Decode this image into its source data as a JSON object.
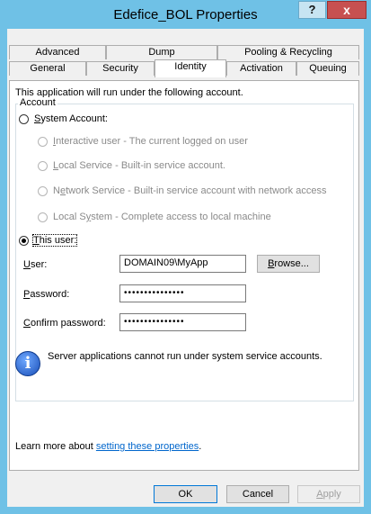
{
  "window": {
    "title": "Edefice_BOL Properties",
    "help_label": "?",
    "close_label": "x"
  },
  "tabs": {
    "row1": [
      "Advanced",
      "Dump",
      "Pooling & Recycling"
    ],
    "row2": [
      "General",
      "Security",
      "Identity",
      "Activation",
      "Queuing"
    ],
    "active": "Identity"
  },
  "identity": {
    "intro": "This application will run under the following account.",
    "group_label": "Account",
    "system_account": {
      "mnemonic": "S",
      "rest": "ystem Account:"
    },
    "options": [
      {
        "mnemonic": "I",
        "rest": "nteractive user - The current logged on user",
        "pre": ""
      },
      {
        "mnemonic": "L",
        "rest": "ocal Service - Built-in service account.",
        "pre": ""
      },
      {
        "pre": "N",
        "mnemonic": "e",
        "rest": "twork Service - Built-in service account with network access"
      },
      {
        "pre": "Local S",
        "mnemonic": "y",
        "rest": "stem - Complete access to local machine"
      }
    ],
    "this_user": {
      "mnemonic": "T",
      "rest": "his user:"
    },
    "user_label": {
      "mnemonic": "U",
      "rest": "ser:"
    },
    "user_value": "DOMAIN09\\MyApp",
    "browse": {
      "mnemonic": "B",
      "rest": "rowse..."
    },
    "password_label": {
      "mnemonic": "P",
      "rest": "assword:"
    },
    "password_value": "•••••••••••••••",
    "confirm_label": {
      "mnemonic": "C",
      "rest": "onfirm password:"
    },
    "confirm_value": "•••••••••••••••",
    "info_text": "Server applications cannot run under system service accounts.",
    "learn_more_prefix": "Learn more about ",
    "learn_more_link": "setting these properties",
    "learn_more_suffix": "."
  },
  "footer": {
    "ok": "OK",
    "cancel": "Cancel",
    "apply_mnemonic": "A",
    "apply_rest": "pply"
  },
  "colors": {
    "titlebar": "#6fc1e6",
    "close_button": "#c75050",
    "link": "#0066cc"
  }
}
